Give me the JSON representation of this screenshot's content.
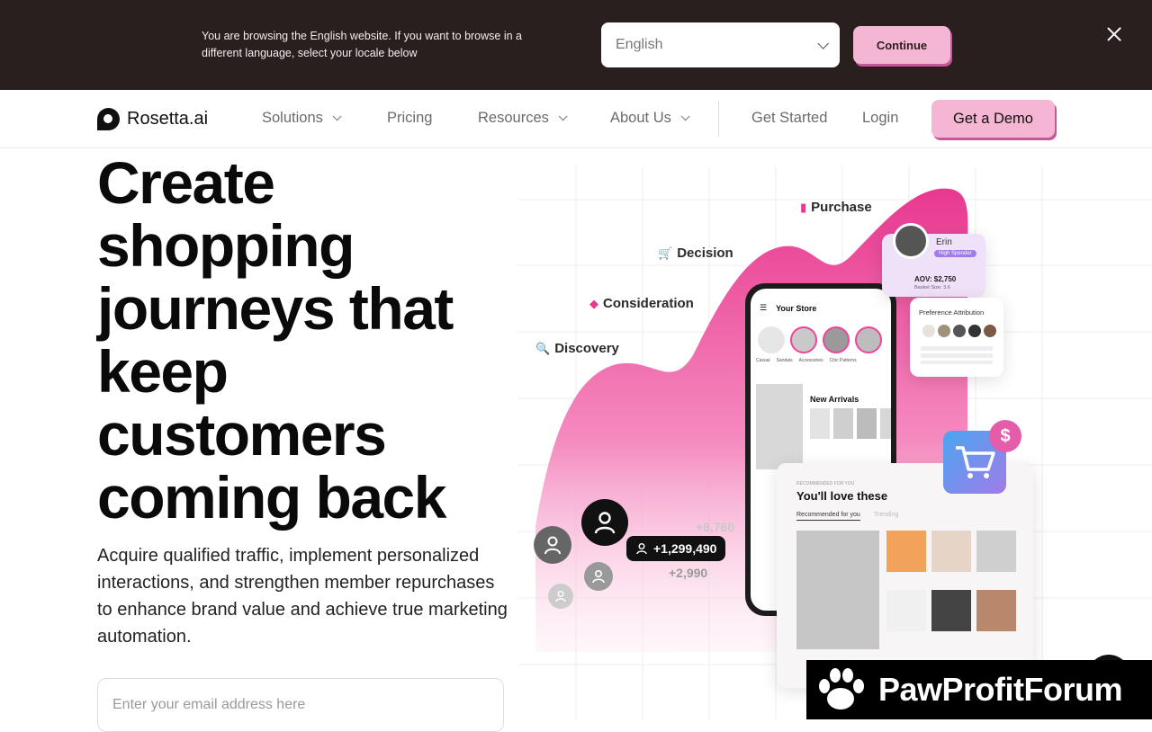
{
  "locale_banner": {
    "message": "You are browsing the English website. If you want to browse in a different language, select your locale below",
    "selected_language": "English",
    "continue_label": "Continue"
  },
  "nav": {
    "brand": "Rosetta.ai",
    "items": [
      {
        "label": "Solutions",
        "has_dropdown": true
      },
      {
        "label": "Pricing",
        "has_dropdown": false
      },
      {
        "label": "Resources",
        "has_dropdown": true
      },
      {
        "label": "About Us",
        "has_dropdown": true
      }
    ],
    "get_started": "Get Started",
    "login": "Login",
    "demo": "Get a Demo"
  },
  "hero": {
    "title": "Create shopping journeys that keep customers coming back",
    "subtitle": "Acquire qualified traffic, implement personalized interactions, and strengthen member repurchases to enhance brand value and achieve true marketing automation.",
    "email_placeholder": "Enter your email address here"
  },
  "illustration": {
    "stages": {
      "discovery": "Discovery",
      "consideration": "Consideration",
      "decision": "Decision",
      "purchase": "Purchase"
    },
    "metrics": {
      "primary": "+1,299,490",
      "secondary_a": "+8,760",
      "secondary_b": "+2,990"
    },
    "profile": {
      "name": "Erin",
      "badge": "High Spender",
      "aov": "AOV: $2,750",
      "basket": "Basket Size: 3.6",
      "attribution_title": "Preference Attribution"
    },
    "phone": {
      "store_title": "Your Store",
      "categories": [
        "Casual",
        "Sandals",
        "Accessories",
        "Chic Patterns"
      ],
      "section": "New Arrivals"
    },
    "recommend": {
      "eyebrow": "RECOMMENDED FOR YOU",
      "title": "You'll love these",
      "tab_active": "Recommended for you",
      "tab_other": "Trending"
    },
    "colors": {
      "accent": "#f0449a",
      "accent_soft": "#f7b3d3",
      "purple": "#a07be8",
      "blue": "#4aa6f0"
    }
  },
  "watermark": "PawProfitForum"
}
